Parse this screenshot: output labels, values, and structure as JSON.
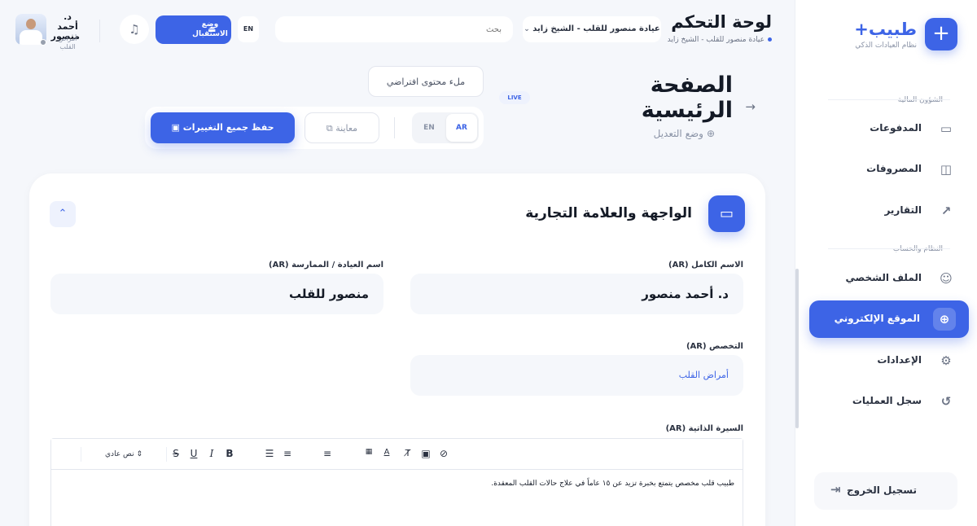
{
  "sidebar": {
    "brand_name": "طبيب+",
    "brand_sub": "نظام العيادات الذكي",
    "brand_icon": "plus-icon",
    "sections": [
      {
        "title": "الشؤون المالية"
      },
      {
        "title": "النظام والحساب"
      }
    ],
    "items": [
      {
        "label": "المدفوعات",
        "icon": "card-icon"
      },
      {
        "label": "المصروفات",
        "icon": "wallet-icon"
      },
      {
        "label": "التقارير",
        "icon": "trend-icon"
      },
      {
        "label": "الملف الشخصي",
        "icon": "user-icon"
      },
      {
        "label": "الموقع الإلكتروني",
        "icon": "globe-icon",
        "active": true
      },
      {
        "label": "الإعدادات",
        "icon": "gear-icon"
      },
      {
        "label": "سجل العمليات",
        "icon": "history-icon"
      }
    ],
    "logout_label": "تسجيل الخروج"
  },
  "header": {
    "title": "لوحة التحكم",
    "subtitle": "عيادة منصور للقلب - الشيخ زايد",
    "clinic_select": "عيادة منصور للقلب - الشيخ زايد",
    "search_placeholder": "بحث",
    "lang": "EN",
    "reception_label": "وضع الاستقبال",
    "user_name": "أحمد منصور",
    "user_prefix": "د.",
    "user_role": "أمراض القلب"
  },
  "page": {
    "title": "الصفحة الرئيسية",
    "mode_label": "وضع التعديل",
    "live_badge": "LIVE",
    "fill_default_label": "ملء محتوى افتراضي",
    "lang_ar": "AR",
    "lang_en": "EN",
    "preview_label": "معاينة",
    "save_label": "حفظ جميع التغييرات"
  },
  "card": {
    "title": "الواجهة والعلامة التجارية",
    "fields": {
      "full_name_label": "الاسم الكامل (AR)",
      "full_name_value": "د. أحمد منصور",
      "clinic_name_label": "اسم العيادة / الممارسة (AR)",
      "clinic_name_value": "منصور للقلب",
      "specialty_label": "التخصص (AR)",
      "specialty_value": "أمراض القلب",
      "bio_label": "السيرة الذاتية (AR)",
      "bio_value": "طبيب قلب مخصص يتمتع بخبرة تزيد عن ١٥ عاماً في علاج حالات القلب المعقدة."
    },
    "editor": {
      "size_label": "نص عادي"
    }
  },
  "colors": {
    "accent": "#3d64e6",
    "background": "#f5f7fb"
  }
}
